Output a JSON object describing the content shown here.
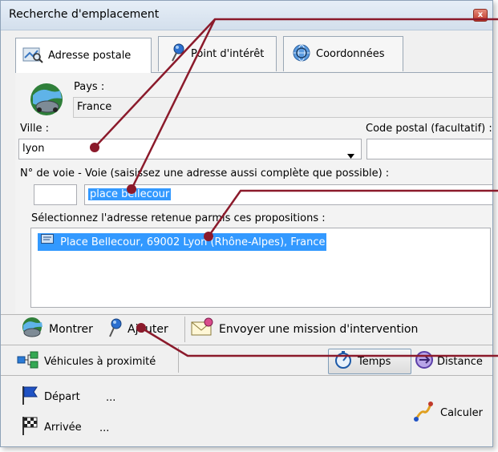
{
  "window": {
    "title": "Recherche d'emplacement",
    "close_glyph": "x"
  },
  "tabs": [
    {
      "label": "Adresse postale",
      "icon": "map-search-icon",
      "active": true
    },
    {
      "label": "Point d'intérêt",
      "icon": "pushpin-icon",
      "active": false
    },
    {
      "label": "Coordonnées",
      "icon": "globe-target-icon",
      "active": false
    }
  ],
  "form": {
    "country_label": "Pays :",
    "country_value": "France",
    "city_label": "Ville :",
    "city_value": "lyon",
    "postal_label": "Code postal (facultatif) :",
    "postal_value": "",
    "street_label": "N° de voie - Voie (saisissez une adresse aussi complète que possible) :",
    "street_number_value": "",
    "street_value": "place bellecour",
    "results_label": "Sélectionnez l'adresse retenue parmis ces propositions :",
    "results": [
      "Place Bellecour, 69002 Lyon (Rhône-Alpes), France"
    ]
  },
  "actions": {
    "show": "Montrer",
    "add": "Ajouter",
    "send_mission": "Envoyer une mission d'intervention",
    "nearby_vehicles": "Véhicules à proximité",
    "time": "Temps",
    "distance": "Distance",
    "departure": "Départ",
    "departure_value": "...",
    "arrival": "Arrivée",
    "arrival_value": "...",
    "calculate": "Calculer"
  },
  "colors": {
    "selection": "#3399ff",
    "annotation": "#8b1a2b"
  }
}
